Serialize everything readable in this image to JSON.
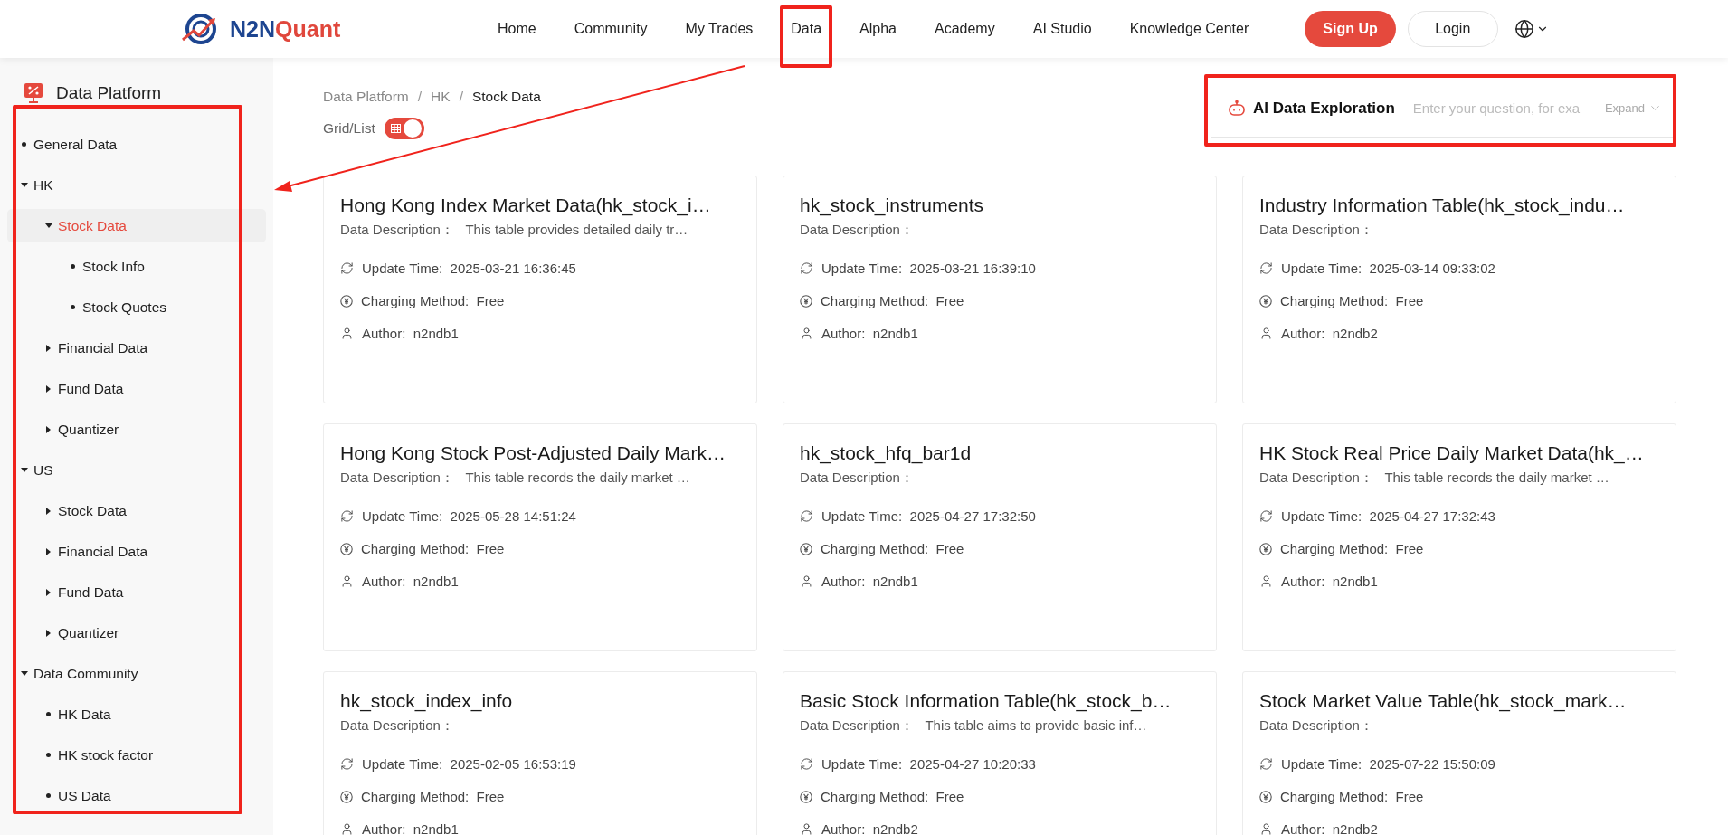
{
  "logo": {
    "text_main": "N2N",
    "text_accent": "Quant"
  },
  "nav": [
    {
      "label": "Home",
      "highlighted": false
    },
    {
      "label": "Community",
      "highlighted": false
    },
    {
      "label": "My Trades",
      "highlighted": false
    },
    {
      "label": "Data",
      "highlighted": true
    },
    {
      "label": "Alpha",
      "highlighted": false
    },
    {
      "label": "Academy",
      "highlighted": false
    },
    {
      "label": "AI Studio",
      "highlighted": false
    },
    {
      "label": "Knowledge Center",
      "highlighted": false
    }
  ],
  "actions": {
    "signup": "Sign Up",
    "login": "Login"
  },
  "sidebar": {
    "title": "Data Platform",
    "highlighted": true,
    "tree": [
      {
        "label": "General Data",
        "kind": "leaf",
        "selected": false
      },
      {
        "label": "HK",
        "kind": "folder",
        "expanded": true,
        "selected": false,
        "children": [
          {
            "label": "Stock Data",
            "kind": "folder",
            "expanded": true,
            "selected": true,
            "children": [
              {
                "label": "Stock Info",
                "kind": "leaf",
                "selected": false
              },
              {
                "label": "Stock Quotes",
                "kind": "leaf",
                "selected": false
              }
            ]
          },
          {
            "label": "Financial Data",
            "kind": "folder",
            "expanded": false,
            "selected": false
          },
          {
            "label": "Fund Data",
            "kind": "folder",
            "expanded": false,
            "selected": false
          },
          {
            "label": "Quantizer",
            "kind": "folder",
            "expanded": false,
            "selected": false
          }
        ]
      },
      {
        "label": "US",
        "kind": "folder",
        "expanded": true,
        "selected": false,
        "children": [
          {
            "label": "Stock Data",
            "kind": "folder",
            "expanded": false,
            "selected": false
          },
          {
            "label": "Financial Data",
            "kind": "folder",
            "expanded": false,
            "selected": false
          },
          {
            "label": "Fund Data",
            "kind": "folder",
            "expanded": false,
            "selected": false
          },
          {
            "label": "Quantizer",
            "kind": "folder",
            "expanded": false,
            "selected": false
          }
        ]
      },
      {
        "label": "Data Community",
        "kind": "folder",
        "expanded": true,
        "selected": false,
        "children": [
          {
            "label": "HK Data",
            "kind": "leaf",
            "selected": false
          },
          {
            "label": "HK stock factor",
            "kind": "leaf",
            "selected": false
          },
          {
            "label": "US Data",
            "kind": "leaf",
            "selected": false
          }
        ]
      }
    ]
  },
  "breadcrumb": [
    "Data Platform",
    "HK",
    "Stock Data"
  ],
  "breadcrumb_separator": "/",
  "view_toggle": {
    "label": "Grid/List",
    "on": true
  },
  "ai_exploration": {
    "title": "AI Data Exploration",
    "placeholder": "Enter your question, for exa",
    "expand": "Expand",
    "highlighted": true
  },
  "annotation_arrow": true,
  "cards": [
    {
      "title": "Hong Kong Index Market Data(hk_stock_i…",
      "description_label": "Data Description：",
      "description": "This table provides detailed daily tr…",
      "update_label": "Update Time:",
      "update_time": "2025-03-21 16:36:45",
      "charging_label": "Charging Method:",
      "charging": "Free",
      "author_label": "Author:",
      "author": "n2ndb1"
    },
    {
      "title": "hk_stock_instruments",
      "description_label": "Data Description：",
      "update_label": "Update Time:",
      "update_time": "2025-03-21 16:39:10",
      "charging_label": "Charging Method:",
      "charging": "Free",
      "author_label": "Author:",
      "author": "n2ndb1"
    },
    {
      "title": "Industry Information Table(hk_stock_indu…",
      "description_label": "Data Description：",
      "update_label": "Update Time:",
      "update_time": "2025-03-14 09:33:02",
      "charging_label": "Charging Method:",
      "charging": "Free",
      "author_label": "Author:",
      "author": "n2ndb2"
    },
    {
      "title": "Hong Kong Stock Post-Adjusted Daily Mark…",
      "description_label": "Data Description：",
      "description": "This table records the daily market …",
      "update_label": "Update Time:",
      "update_time": "2025-05-28 14:51:24",
      "charging_label": "Charging Method:",
      "charging": "Free",
      "author_label": "Author:",
      "author": "n2ndb1"
    },
    {
      "title": "hk_stock_hfq_bar1d",
      "description_label": "Data Description：",
      "update_label": "Update Time:",
      "update_time": "2025-04-27 17:32:50",
      "charging_label": "Charging Method:",
      "charging": "Free",
      "author_label": "Author:",
      "author": "n2ndb1"
    },
    {
      "title": "HK Stock Real Price Daily Market Data(hk_…",
      "description_label": "Data Description：",
      "description": "This table records the daily market …",
      "update_label": "Update Time:",
      "update_time": "2025-04-27 17:32:43",
      "charging_label": "Charging Method:",
      "charging": "Free",
      "author_label": "Author:",
      "author": "n2ndb1"
    },
    {
      "title": "hk_stock_index_info",
      "description_label": "Data Description：",
      "update_label": "Update Time:",
      "update_time": "2025-02-05 16:53:19",
      "charging_label": "Charging Method:",
      "charging": "Free",
      "author_label": "Author:",
      "author": "n2ndb1"
    },
    {
      "title": "Basic Stock Information Table(hk_stock_b…",
      "description_label": "Data Description：",
      "description": "This table aims to provide basic inf…",
      "update_label": "Update Time:",
      "update_time": "2025-04-27 10:20:33",
      "charging_label": "Charging Method:",
      "charging": "Free",
      "author_label": "Author:",
      "author": "n2ndb2"
    },
    {
      "title": "Stock Market Value Table(hk_stock_mark…",
      "description_label": "Data Description：",
      "update_label": "Update Time:",
      "update_time": "2025-07-22 15:50:09",
      "charging_label": "Charging Method:",
      "charging": "Free",
      "author_label": "Author:",
      "author": "n2ndb2"
    }
  ]
}
